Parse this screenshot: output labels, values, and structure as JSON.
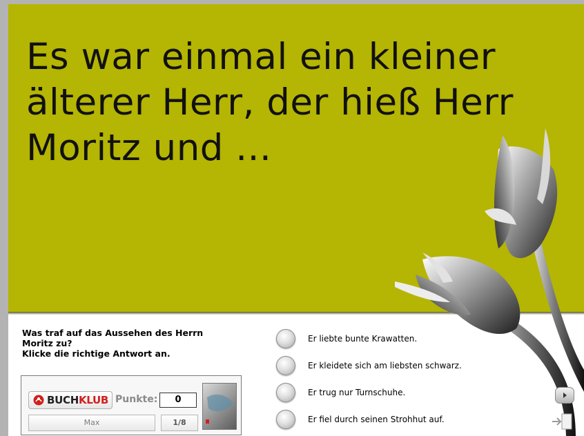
{
  "story": {
    "lines": [
      "Es war einmal ein kleiner",
      "älterer Herr, der hieß Herr",
      "Moritz und ..."
    ]
  },
  "question": {
    "lines": [
      "Was traf auf das Aussehen des Herrn",
      "Moritz zu?",
      "Klicke die richtige Antwort an."
    ]
  },
  "answers": [
    {
      "label": "Er liebte bunte Krawatten."
    },
    {
      "label": "Er kleidete sich am liebsten schwarz."
    },
    {
      "label": "Er trug nur Turnschuhe."
    },
    {
      "label": "Er fiel durch seinen Strohhut auf."
    }
  ],
  "scorebox": {
    "logo_part1": "BUCH",
    "logo_part2": "KLUB",
    "points_label": "Punkte:",
    "points_value": "0",
    "player_name": "Max",
    "page_counter": "1/8"
  },
  "colors": {
    "stage": "#b5b503",
    "brand_red": "#d0201d"
  },
  "icons": {
    "next": "play-triangle-icon",
    "exit": "exit-door-icon",
    "decoration": "tulip-icon",
    "logo": "buchklub-logo-icon"
  }
}
